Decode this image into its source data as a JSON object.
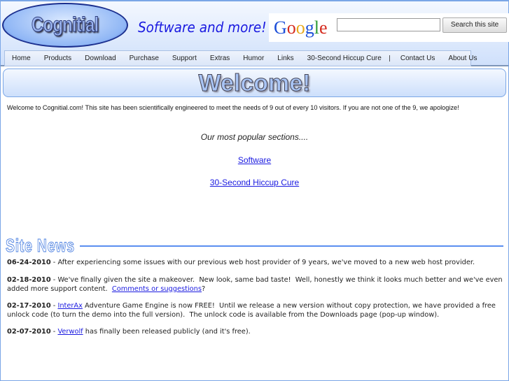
{
  "header": {
    "logo_text": "Cognitial",
    "tagline": "Software and more!",
    "google_logo": "Google",
    "search_value": "",
    "search_button": "Search this site"
  },
  "nav": {
    "items": [
      "Home",
      "Products",
      "Download",
      "Purchase",
      "Support",
      "Extras",
      "Humor",
      "Links",
      "30-Second Hiccup Cure"
    ],
    "separator": "|",
    "items2": [
      "Contact Us",
      "About Us"
    ]
  },
  "welcome": {
    "title": "Welcome!",
    "intro": "Welcome to Cognitial.com! This site has been scientifically engineered to meet the needs of 9 out of every 10 visitors. If you are not one of the 9, we apologize!",
    "popular_heading": "Our most popular sections....",
    "popular_links": [
      "Software",
      "30-Second Hiccup Cure"
    ]
  },
  "news": {
    "heading": "Site News",
    "items": [
      {
        "date": "06-24-2010",
        "sep": " - ",
        "text": "After experiencing some issues with our previous web host provider of 9 years, we've moved to a new web host provider."
      },
      {
        "date": "02-18-2010",
        "sep": " - ",
        "text": "We've finally given the site a makeover.  New look, same bad taste!  Well, honestly we think it looks much better and we've even added more support content.  ",
        "link": "Comments or suggestions",
        "after": "?"
      },
      {
        "date": "02-17-2010",
        "sep": " - ",
        "link": "InterAx",
        "after": " Adventure Game Engine is now FREE!  Until we release a new version without copy protection, we have provided a free unlock code (to turn the demo into the full version).  The unlock code is available from the Downloads page (pop-up window)."
      },
      {
        "date": "02-07-2010",
        "sep": " - ",
        "link": "Verwolf",
        "after": " has finally been released publicly (and it's free)."
      }
    ]
  }
}
